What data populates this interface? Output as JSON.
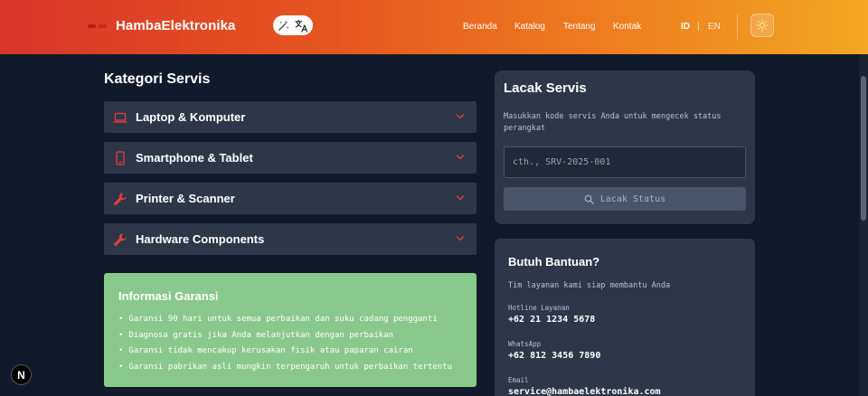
{
  "header": {
    "brand": "HambaElektronika",
    "nav": [
      "Beranda",
      "Katalog",
      "Tentang",
      "Kontak"
    ],
    "lang_active": "ID",
    "lang_separator": "|",
    "lang_other": "EN"
  },
  "categories": {
    "title": "Kategori Servis",
    "items": [
      {
        "label": "Laptop & Komputer",
        "icon": "laptop-icon"
      },
      {
        "label": "Smartphone & Tablet",
        "icon": "smartphone-icon"
      },
      {
        "label": "Printer & Scanner",
        "icon": "wrench-icon"
      },
      {
        "label": "Hardware Components",
        "icon": "wrench-icon"
      }
    ]
  },
  "warranty": {
    "title": "Informasi Garansi",
    "items": [
      "Garansi 90 hari untuk semua perbaikan dan suku cadang pengganti",
      "Diagnosa gratis jika Anda melanjutkan dengan perbaikan",
      "Garansi tidak mencakup kerusakan fisik atau paparan cairan",
      "Garansi pabrikan asli mungkin terpengaruh untuk perbaikan tertentu"
    ]
  },
  "tracking": {
    "title": "Lacak Servis",
    "description": "Masukkan kode servis Anda untuk mengecek status perangkat",
    "placeholder": "cth., SRV-2025-001",
    "button": "Lacak Status"
  },
  "help": {
    "title": "Butuh Bantuan?",
    "description": "Tim layanan kami siap membantu Anda",
    "contacts": [
      {
        "label": "Hotline Layanan",
        "value": "+62 21 1234 5678"
      },
      {
        "label": "WhatsApp",
        "value": "+62 812 3456 7890"
      },
      {
        "label": "Email",
        "value": "service@hambaelektronika.com"
      }
    ]
  },
  "badge": "N",
  "colors": {
    "accent": "#e53e3e",
    "panel": "#2d3748",
    "background": "#111a2b",
    "warranty": "#89c98b"
  }
}
